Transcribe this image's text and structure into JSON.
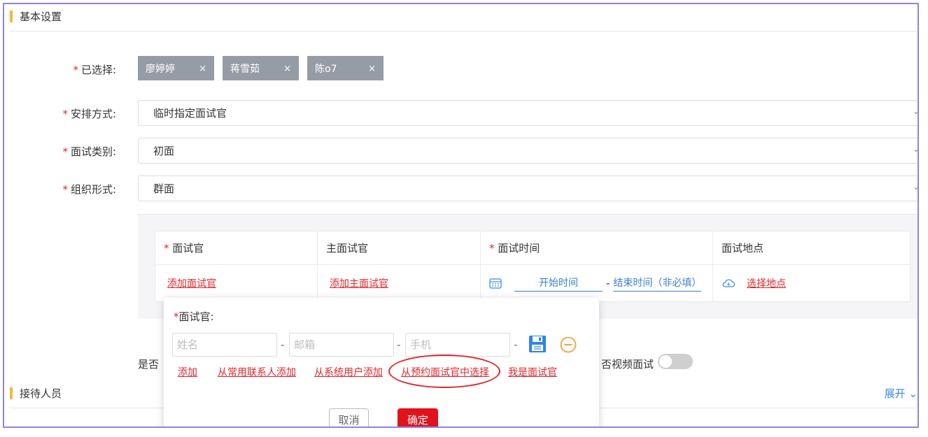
{
  "basic_settings": {
    "title": "基本设置"
  },
  "selected": {
    "label": "已选择:",
    "tags": [
      {
        "name": "廖婷婷",
        "close": "×"
      },
      {
        "name": "蒋雪茹",
        "close": "×"
      },
      {
        "name": "陈o7",
        "close": "×"
      }
    ]
  },
  "arrangement": {
    "label": "安排方式:",
    "value": "临时指定面试官"
  },
  "category": {
    "label": "面试类别:",
    "value": "初面"
  },
  "format": {
    "label": "组织形式:",
    "value": "群面"
  },
  "required_mark": "*",
  "chevron": "⌄",
  "table": {
    "headers": [
      "面试官",
      "主面试官",
      "面试时间",
      "面试地点"
    ],
    "add_interviewer": "添加面试官",
    "add_main_interviewer": "添加主面试官",
    "start_time": "开始时间",
    "time_dash": "-",
    "end_time": "结束时间（非必填）",
    "choose_location": "选择地点"
  },
  "below": {
    "left_fragment": "是否",
    "video_label": "否视频面试",
    "video_enabled": false
  },
  "reception": {
    "title": "接待人员",
    "expand": "展开"
  },
  "popup": {
    "title": "面试官:",
    "name_placeholder": "姓名",
    "email_placeholder": "邮箱",
    "phone_placeholder": "手机",
    "dash": "-",
    "links": [
      "添加",
      "从常用联系人添加",
      "从系统用户添加",
      "从预约面试官中选择",
      "我是面试官"
    ],
    "cancel": "取消",
    "confirm": "确定"
  },
  "colors": {
    "accent_red": "#e0262c",
    "link_blue": "#3b8be6",
    "section_bar": "#f3b73f",
    "frame": "#8f83e6"
  }
}
